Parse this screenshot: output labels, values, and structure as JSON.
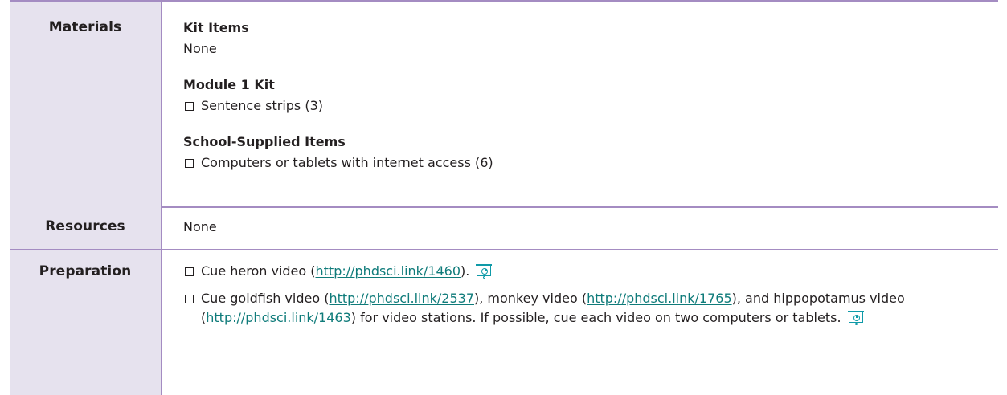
{
  "materials": {
    "label": "Materials",
    "kit_items": {
      "heading": "Kit Items",
      "value": "None"
    },
    "module_kit": {
      "heading": "Module 1 Kit",
      "items": [
        "Sentence strips (3)"
      ]
    },
    "school_supplied": {
      "heading": "School-Supplied Items",
      "items": [
        "Computers or tablets with internet access (6)"
      ]
    }
  },
  "resources": {
    "label": "Resources",
    "value": "None"
  },
  "preparation": {
    "label": "Preparation",
    "item1": {
      "before": "Cue heron video (",
      "link": "http://phdsci.link/1460",
      "after": ").",
      "icon": "slide-presentation-icon"
    },
    "item2": {
      "text1": "Cue goldfish video (",
      "link1": "http://phdsci.link/2537",
      "text2": "), monkey video (",
      "link2": "http://phdsci.link/1765",
      "text3": "), and hippopotamus video (",
      "link3": "http://phdsci.link/1463",
      "text4": ") for video stations. If possible, cue each video on two computers or tablets.",
      "icon": "slide-presentation-icon"
    }
  },
  "colors": {
    "border": "#a48cc2",
    "label_bg": "#e6e2ee",
    "link": "#0f7b7a",
    "icon": "#0f9aa8"
  }
}
